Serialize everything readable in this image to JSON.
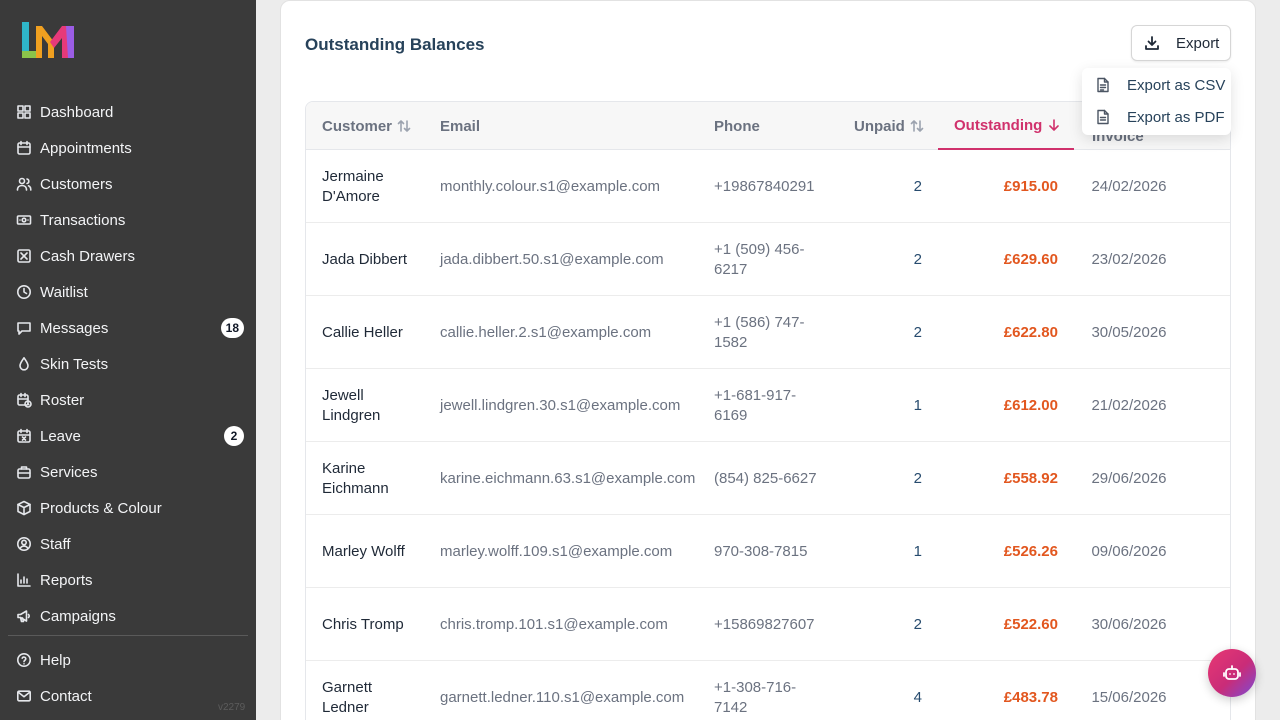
{
  "app": {
    "version": "v2279",
    "logo_text": "LM"
  },
  "sidebar": {
    "items": [
      {
        "label": "Dashboard",
        "icon": "dashboard-icon"
      },
      {
        "label": "Appointments",
        "icon": "calendar-icon"
      },
      {
        "label": "Customers",
        "icon": "users-icon"
      },
      {
        "label": "Transactions",
        "icon": "banknote-icon"
      },
      {
        "label": "Cash Drawers",
        "icon": "cash-drawer-icon"
      },
      {
        "label": "Waitlist",
        "icon": "clock-icon"
      },
      {
        "label": "Messages",
        "icon": "message-icon",
        "badge": "18"
      },
      {
        "label": "Skin Tests",
        "icon": "droplet-icon"
      },
      {
        "label": "Roster",
        "icon": "calendar-clock-icon"
      },
      {
        "label": "Leave",
        "icon": "calendar-x-icon",
        "badge": "2"
      },
      {
        "label": "Services",
        "icon": "briefcase-icon"
      },
      {
        "label": "Products & Colour",
        "icon": "package-icon"
      },
      {
        "label": "Staff",
        "icon": "user-circle-icon"
      },
      {
        "label": "Reports",
        "icon": "bar-chart-icon"
      },
      {
        "label": "Campaigns",
        "icon": "megaphone-icon"
      }
    ],
    "bottom": [
      {
        "label": "Help",
        "icon": "help-circle-icon"
      },
      {
        "label": "Contact",
        "icon": "mail-icon"
      }
    ]
  },
  "page": {
    "title": "Outstanding Balances",
    "export_label": "Export",
    "export_menu": [
      {
        "label": "Export as CSV",
        "icon": "file-csv-icon"
      },
      {
        "label": "Export as PDF",
        "icon": "file-pdf-icon"
      }
    ]
  },
  "table": {
    "columns": {
      "customer": "Customer",
      "email": "Email",
      "phone": "Phone",
      "unpaid": "Unpaid",
      "outstanding": "Outstanding",
      "invoice": "Invoice"
    },
    "sorted_column": "Outstanding",
    "sort_direction": "descending",
    "rows": [
      {
        "name": "Jermaine D'Amore",
        "email": "monthly.colour.s1@example.com",
        "phone": "+19867840291",
        "unpaid": "2",
        "outstanding": "£915.00",
        "invoice": "24/02/2026"
      },
      {
        "name": "Jada Dibbert",
        "email": "jada.dibbert.50.s1@example.com",
        "phone": "+1 (509) 456-6217",
        "unpaid": "2",
        "outstanding": "£629.60",
        "invoice": "23/02/2026"
      },
      {
        "name": "Callie Heller",
        "email": "callie.heller.2.s1@example.com",
        "phone": "+1 (586) 747-1582",
        "unpaid": "2",
        "outstanding": "£622.80",
        "invoice": "30/05/2026"
      },
      {
        "name": "Jewell Lindgren",
        "email": "jewell.lindgren.30.s1@example.com",
        "phone": "+1-681-917-6169",
        "unpaid": "1",
        "outstanding": "£612.00",
        "invoice": "21/02/2026"
      },
      {
        "name": "Karine Eichmann",
        "email": "karine.eichmann.63.s1@example.com",
        "phone": "(854) 825-6627",
        "unpaid": "2",
        "outstanding": "£558.92",
        "invoice": "29/06/2026"
      },
      {
        "name": "Marley Wolff",
        "email": "marley.wolff.109.s1@example.com",
        "phone": "970-308-7815",
        "unpaid": "1",
        "outstanding": "£526.26",
        "invoice": "09/06/2026"
      },
      {
        "name": "Chris Tromp",
        "email": "chris.tromp.101.s1@example.com",
        "phone": "+15869827607",
        "unpaid": "2",
        "outstanding": "£522.60",
        "invoice": "30/06/2026"
      },
      {
        "name": "Garnett Ledner",
        "email": "garnett.ledner.110.s1@example.com",
        "phone": "+1-308-716-7142",
        "unpaid": "4",
        "outstanding": "£483.78",
        "invoice": "15/06/2026"
      }
    ]
  },
  "colors": {
    "sidebar_bg": "#3a3a3a",
    "accent": "#d0316c",
    "amount": "#e2571f",
    "title": "#27425a"
  },
  "assistant": {
    "icon": "bot-icon"
  }
}
